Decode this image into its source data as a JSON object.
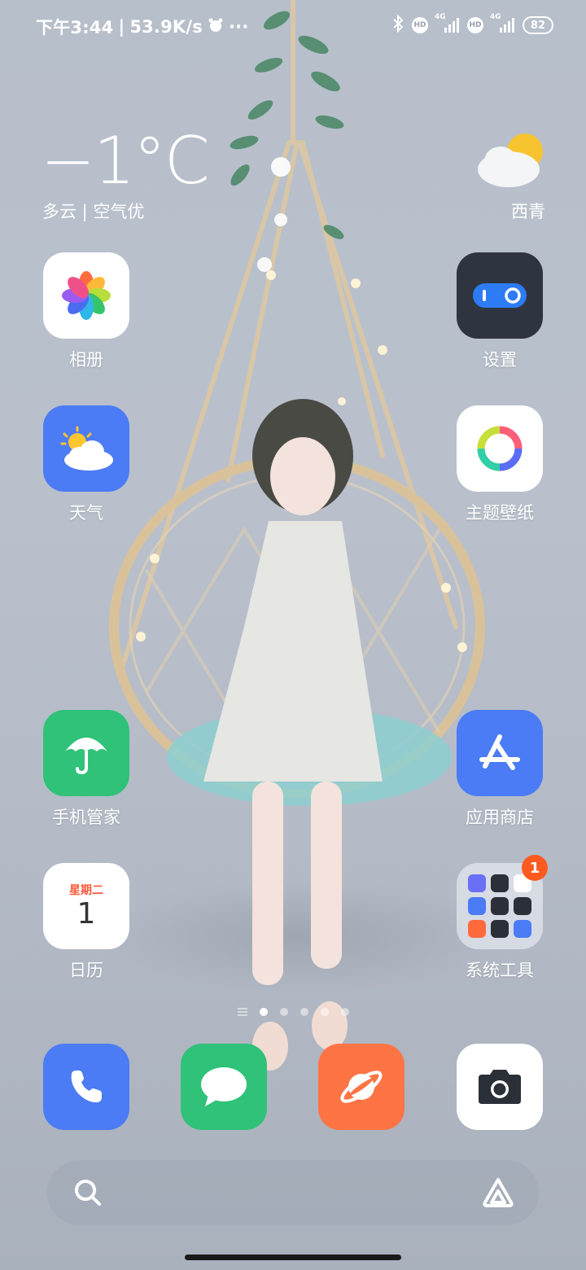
{
  "status_bar": {
    "time": "下午3:44",
    "separator": "|",
    "net_speed": "53.9K/s",
    "more": "···",
    "network_1": "4G",
    "network_2": "4G",
    "hd_1": "HD",
    "hd_2": "HD",
    "battery": "82"
  },
  "weather": {
    "temperature": "−1°C",
    "condition": "多云 | 空气优",
    "city": "西青",
    "icon": "cloud-sun-icon"
  },
  "apps": {
    "photos": {
      "label": "相册",
      "icon": "photos-pinwheel-icon"
    },
    "settings": {
      "label": "设置",
      "icon": "toggle-icon",
      "color": "#2f3540"
    },
    "weather": {
      "label": "天气",
      "icon": "sun-cloud-icon",
      "color": "#4b7bf5"
    },
    "themes": {
      "label": "主题壁纸",
      "icon": "color-ring-icon"
    },
    "security": {
      "label": "手机管家",
      "icon": "umbrella-icon",
      "color": "#2fc278"
    },
    "app_store": {
      "label": "应用商店",
      "icon": "app-store-icon",
      "color": "#4b7bf5"
    },
    "calendar": {
      "label": "日历",
      "weekday": "星期二",
      "day": "1"
    },
    "system_tools": {
      "label": "系统工具",
      "badge": "1"
    }
  },
  "dock": {
    "phone": {
      "icon": "phone-icon",
      "color": "#4b7bf5"
    },
    "messages": {
      "icon": "message-icon",
      "color": "#2fc278"
    },
    "browser": {
      "icon": "planet-icon",
      "color": "#ff7444"
    },
    "camera": {
      "icon": "camera-icon"
    }
  },
  "pages": {
    "count": 5,
    "active": 1
  }
}
